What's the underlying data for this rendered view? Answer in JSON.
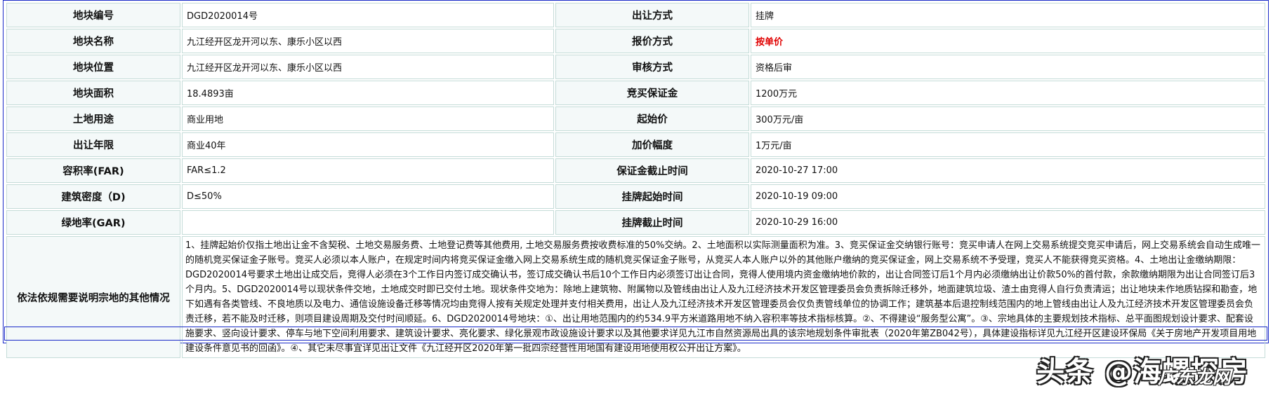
{
  "rows": [
    {
      "l1": "地块编号",
      "v1": "DGD2020014号",
      "l2": "出让方式",
      "v2": "挂牌"
    },
    {
      "l1": "地块名称",
      "v1": "九江经开区龙开河以东、康乐小区以西",
      "l2": "报价方式",
      "v2": "按单价"
    },
    {
      "l1": "地块位置",
      "v1": "九江经开区龙开河以东、康乐小区以西",
      "l2": "审核方式",
      "v2": "资格后审"
    },
    {
      "l1": "地块面积",
      "v1": "18.4893亩",
      "l2": "竞买保证金",
      "v2": "1200万元"
    },
    {
      "l1": "土地用途",
      "v1": "商业用地",
      "l2": "起始价",
      "v2": "300万元/亩"
    },
    {
      "l1": "出让年限",
      "v1": "商业40年",
      "l2": "加价幅度",
      "v2": "1万元/亩"
    },
    {
      "l1": "容积率(FAR)",
      "v1": "FAR≤1.2",
      "l2": "保证金截止时间",
      "v2": "2020-10-27 17:00"
    },
    {
      "l1": "建筑密度（D)",
      "v1": "D≤50%",
      "l2": "挂牌起始时间",
      "v2": "2020-10-19 09:00"
    },
    {
      "l1": "绿地率(GAR)",
      "v1": "",
      "l2": "挂牌截止时间",
      "v2": "2020-10-29 16:00"
    }
  ],
  "other": {
    "label": "依法依规需要说明宗地的其他情况",
    "text": " 1、挂牌起始价仅指土地出让金不含契税、土地交易服务费、土地登记费等其他费用, 土地交易服务费按收费标准的50%交纳。2、土地面积以实际测量面积为准。3、竞买保证金交纳银行账号：竞买申请人在网上交易系统提交竞买申请后，网上交易系统会自动生成唯一的随机竞买保证金子账号。竞买人必须以本人账户，在规定时间内将竞买保证金缴入网上交易系统生成的随机竞买保证金子账号，从竞买人本人账户以外的其他账户缴纳的竞买保证金，网上交易系统不予受理，竞买人不能获得竞买资格。4、土地出让金缴纳期限：DGD2020014号要求土地出让成交后，竞得人必须在3个工作日内签订成交确认书，签订成交确认书后10个工作日内必须签订出让合同，竞得人使用境内资金缴纳地价款的，出让合同签订后1个月内必须缴纳出让价款50%的首付款，余款缴纳期限为出让合同签订后3个月内。5、DGD2020014号以现状条件交地，土地成交时即已交付土地。现状条件交地为：除地上建筑物、附属物以及管线由出让人及九江经济技术开发区管理委员会负责拆除迁移外，地面建筑垃圾、渣土由竞得人自行负责清运；出让地块未作地质钻探和勘查，地下如遇有各类管线、不良地质以及电力、通信设施设备迁移等情况均由竞得人按有关规定处理并支付相关费用，出让人及九江经济技术开发区管理委员会仅负责管线单位的协调工作；建筑基本后退控制线范围内的地上管线由出让人及九江经济技术开发区管理委员会负责迁移，若不能及时迁移，则项目建设周期及交付时间顺延。6、DGD2020014号地块：①、出让用地范围内的约534.9平方米道路用地不纳入容积率等技术指标核算。②、不得建设“服务型公寓”。③、宗地具体的主要规划技术指标、总平面图规划设计要求、配套设施要求、竖向设计要求、停车与地下空间利用要求、建筑设计要求、亮化要求、绿化景观市政设施设计要求以及其他要求详见九江市自然资源局出具的该宗地规划条件审批表（2020年第ZB042号），具体建设指标详见九江经开区建设环保局《关于房地产开发项目用地建设条件意见书的回函》。④、其它未尽事宜详见出让文件《九江经开区2020年第一批四宗经营性用地国有建设用地使用权公开出让方案》。"
  },
  "watermark": {
    "main": "头条 @海螺探房",
    "sub": "广东龙网"
  },
  "colors": {
    "border": "#c5dcd8",
    "label_bg": "#f4f9f9",
    "accent_red": "#e00000",
    "frame_blue": "#1a2bc8"
  }
}
